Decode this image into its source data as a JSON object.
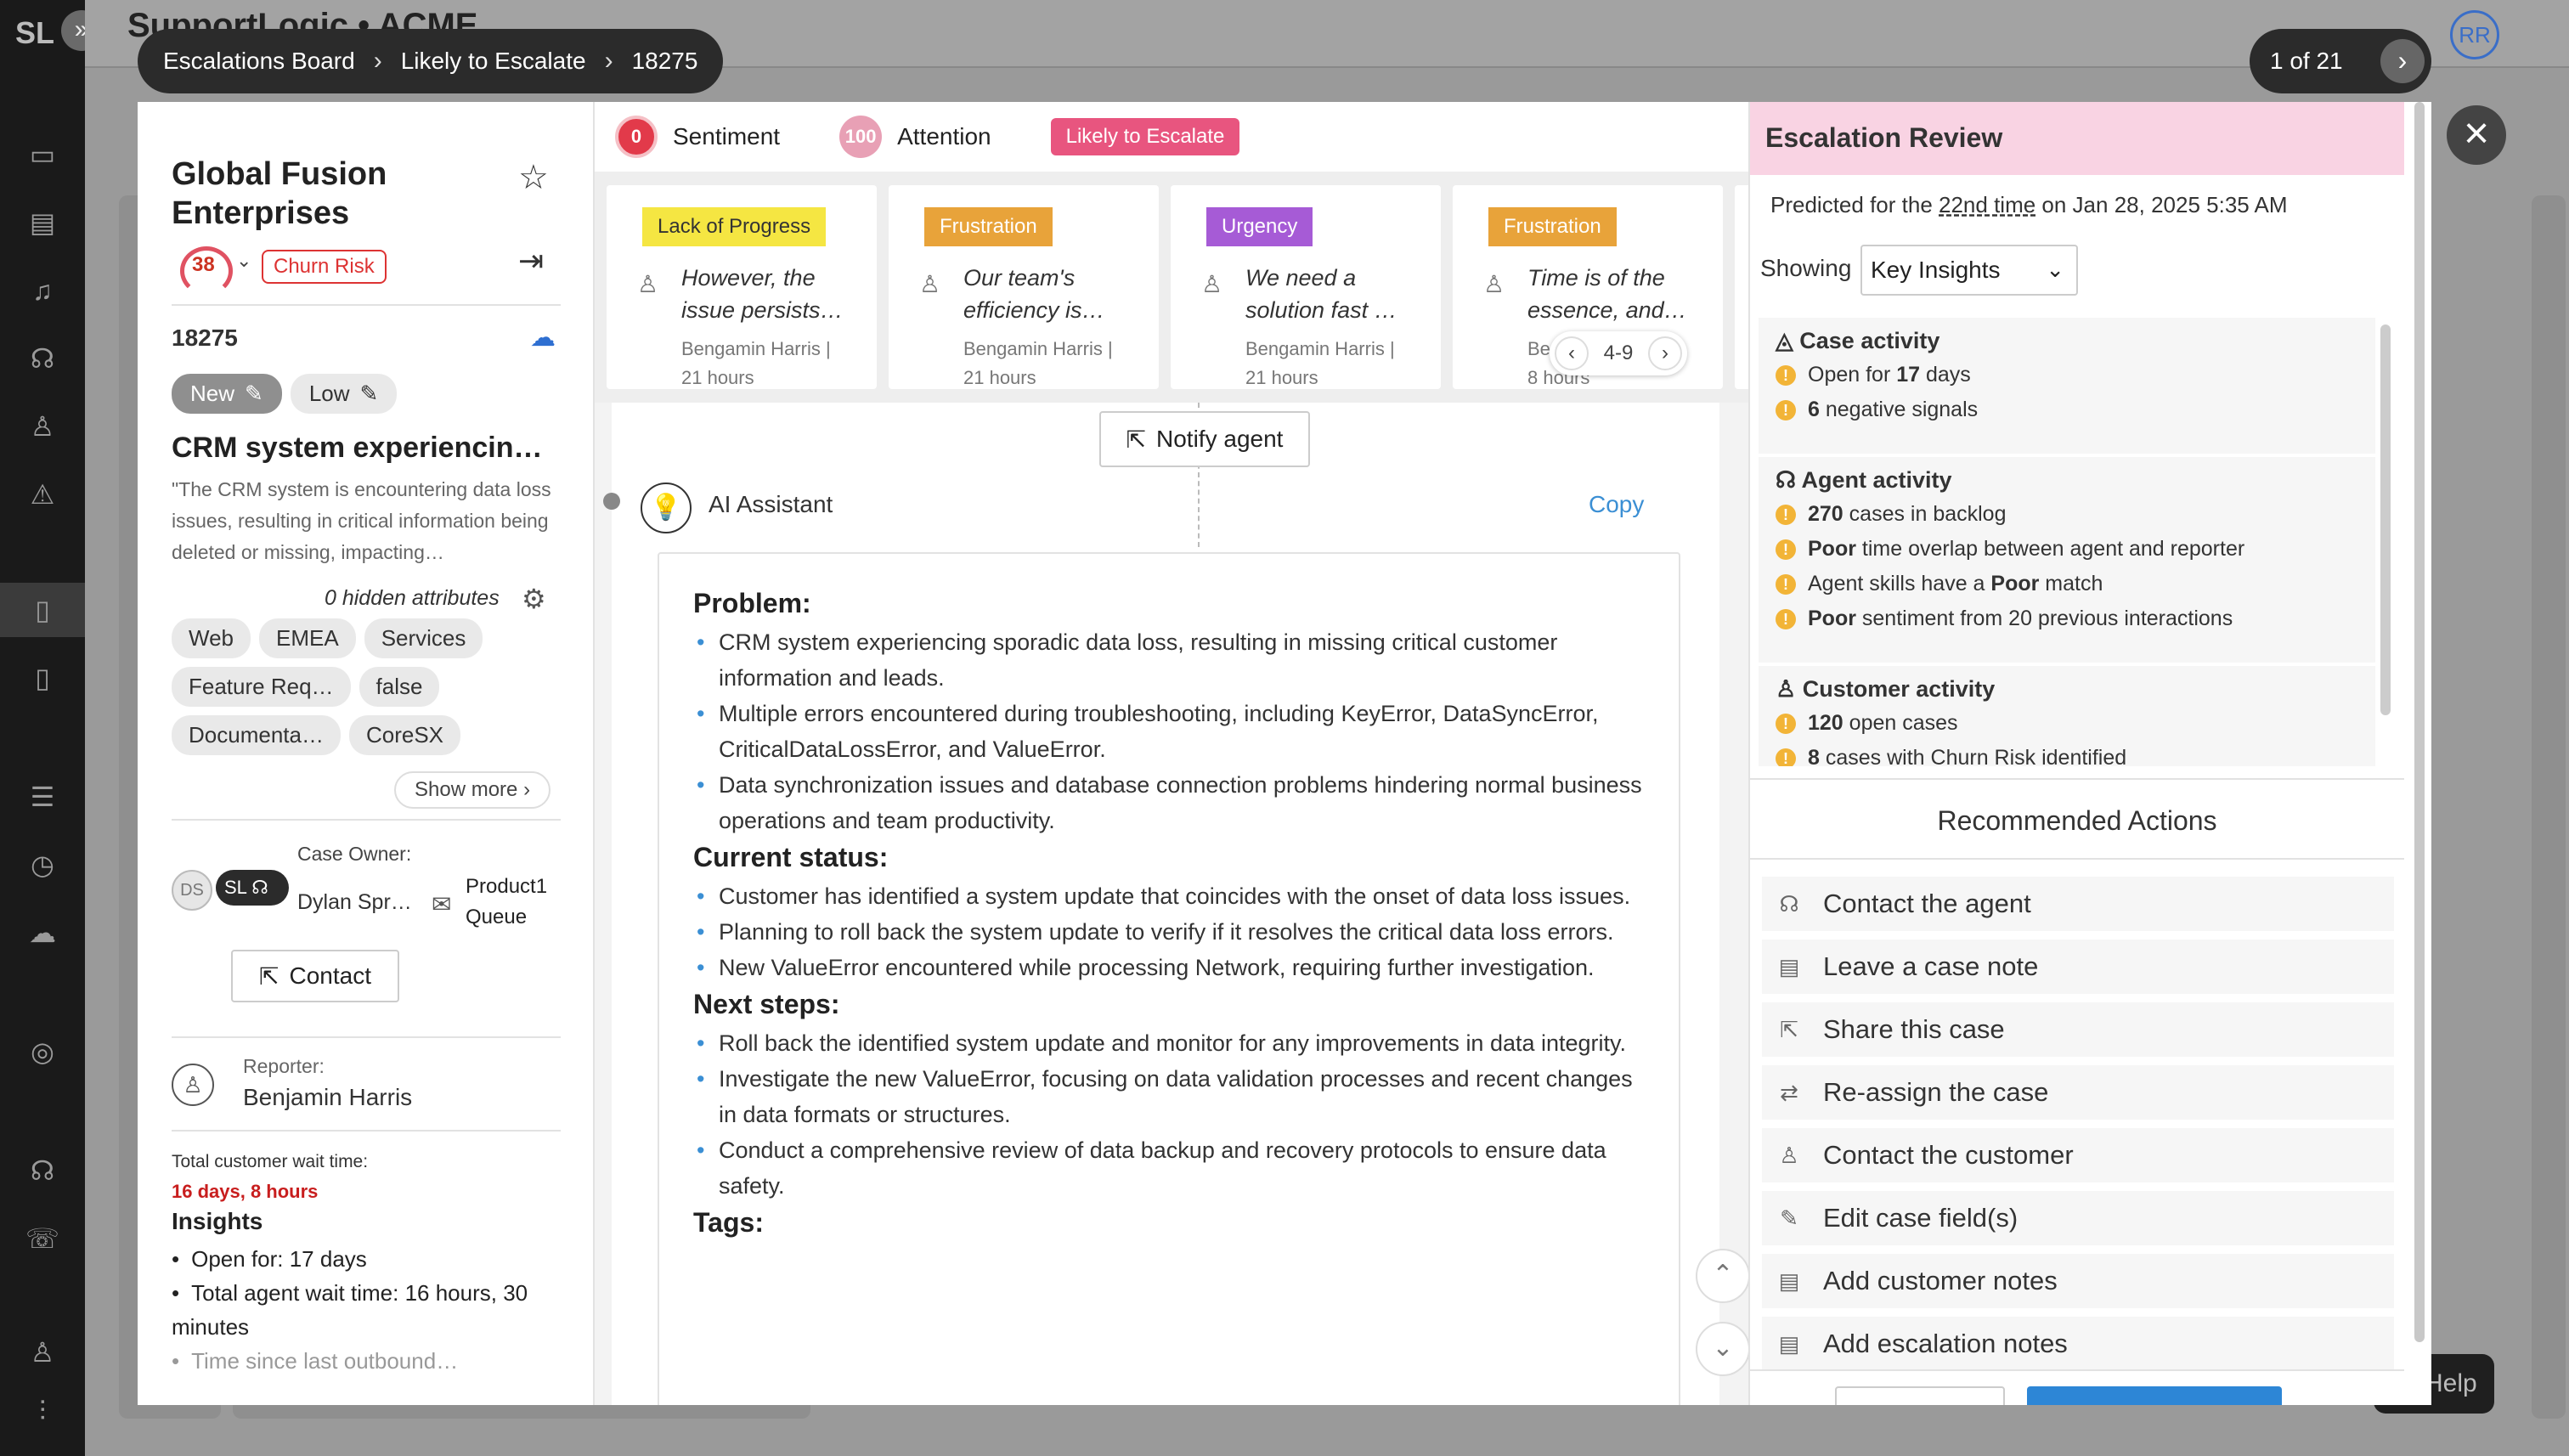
{
  "nav": {
    "logo": "SL",
    "expand_icon": "»"
  },
  "background": {
    "title": "SupportLogic • ACME"
  },
  "breadcrumb": {
    "items": [
      "Escalations Board",
      "Likely to Escalate",
      "18275"
    ]
  },
  "pager": {
    "text": "1 of 21"
  },
  "user_avatar": "RR",
  "help": "Help",
  "case": {
    "account": "Global Fusion Enterprises",
    "score": "38",
    "churn_badge": "Churn Risk",
    "case_number": "18275",
    "status": "New",
    "priority": "Low",
    "subject": "CRM system experiencin…",
    "description": "\"The CRM system is encountering data loss issues, resulting in critical information being deleted or missing, impacting…",
    "hidden_attrs": "0 hidden attributes",
    "tags": [
      "Web",
      "EMEA",
      "Services",
      "Feature Req…",
      "false",
      "Documenta…",
      "CoreSX"
    ],
    "show_more": "Show more",
    "owner_label": "Case Owner:",
    "owner_initials": "DS",
    "owner_sl": "SL",
    "owner_name": "Dylan Spr…",
    "queue_name": "Product1",
    "queue_label": "Queue",
    "contact_label": "Contact",
    "reporter_label": "Reporter:",
    "reporter_name": "Benjamin Harris",
    "wait_label": "Total customer wait time:",
    "wait_value": "16 days, 8 hours",
    "insights_title": "Insights",
    "insights": [
      "Open for: 17 days",
      "Total agent wait time: 16 hours, 30 minutes",
      "Time since last outbound…"
    ]
  },
  "center": {
    "sentiment_score": "0",
    "sentiment_label": "Sentiment",
    "attention_score": "100",
    "attention_label": "Attention",
    "escalate_badge": "Likely to Escalate",
    "signal_cards": [
      {
        "tag": "Lack of Progress",
        "quote": "However, the issue persists…",
        "author": "Bengamin Harris |",
        "time": "21 hours",
        "color": "#f5e642"
      },
      {
        "tag": "Frustration",
        "quote": "Our team's efficiency is…",
        "author": "Bengamin Harris |",
        "time": "21 hours",
        "color": "#e8a33a"
      },
      {
        "tag": "Urgency",
        "quote": "We need a solution fast …",
        "author": "Bengamin Harris |",
        "time": "21 hours",
        "color": "#a65bd6"
      },
      {
        "tag": "Frustration",
        "quote": "Time is of the essence, and…",
        "author": "Ben",
        "time": "8 hours",
        "color": "#e8a33a"
      }
    ],
    "card_range": "4-9",
    "notify_label": "Notify agent",
    "ai_label": "AI Assistant",
    "copy_label": "Copy",
    "ai_sections": [
      {
        "heading": "Problem:",
        "bullets": [
          "CRM system experiencing sporadic data loss, resulting in missing critical customer information and leads.",
          "Multiple errors encountered during troubleshooting, including KeyError, DataSyncError, CriticalDataLossError, and ValueError.",
          "Data synchronization issues and database connection problems hindering normal business operations and team productivity."
        ]
      },
      {
        "heading": "Current status:",
        "bullets": [
          "Customer has identified a system update that coincides with the onset of data loss issues.",
          "Planning to roll back the system update to verify if it resolves the critical data loss errors.",
          "New ValueError encountered while processing Network, requiring further investigation."
        ]
      },
      {
        "heading": "Next steps:",
        "bullets": [
          "Roll back the identified system update and monitor for any improvements in data integrity.",
          "Investigate the new ValueError, focusing on data validation processes and recent changes in data formats or structures.",
          "Conduct a comprehensive review of data backup and recovery protocols to ensure data safety."
        ]
      },
      {
        "heading": "Tags:",
        "bullets": []
      }
    ]
  },
  "review": {
    "title": "Escalation Review",
    "predicted_prefix": "Predicted for the ",
    "predicted_count": "22nd time",
    "predicted_suffix": " on Jan 28, 2025 5:35 AM",
    "showing_label": "Showing",
    "showing_value": "Key Insights",
    "sections": [
      {
        "title": "Case activity",
        "items": [
          [
            "Open for ",
            "17",
            " days"
          ],
          [
            "",
            "6",
            " negative signals"
          ]
        ]
      },
      {
        "title": "Agent activity",
        "items": [
          [
            "",
            "270",
            " cases in backlog"
          ],
          [
            "",
            "Poor",
            " time overlap between agent and reporter"
          ],
          [
            "Agent skills have a ",
            "Poor",
            " match"
          ],
          [
            "",
            "Poor",
            " sentiment from 20 previous interactions"
          ]
        ]
      },
      {
        "title": "Customer activity",
        "items": [
          [
            "",
            "120",
            " open cases"
          ],
          [
            "",
            "8",
            " cases with Churn Risk identified"
          ]
        ]
      }
    ],
    "recommended_title": "Recommended Actions",
    "actions": [
      {
        "label": "Contact the agent",
        "icon": "headset-icon"
      },
      {
        "label": "Leave a case note",
        "icon": "note-icon"
      },
      {
        "label": "Share this case",
        "icon": "share-icon"
      },
      {
        "label": "Re-assign the case",
        "icon": "reassign-icon"
      },
      {
        "label": "Contact the customer",
        "icon": "person-icon"
      },
      {
        "label": "Edit case field(s)",
        "icon": "pencil-icon"
      },
      {
        "label": "Add customer notes",
        "icon": "note-icon"
      },
      {
        "label": "Add escalation notes",
        "icon": "note-icon"
      }
    ]
  }
}
